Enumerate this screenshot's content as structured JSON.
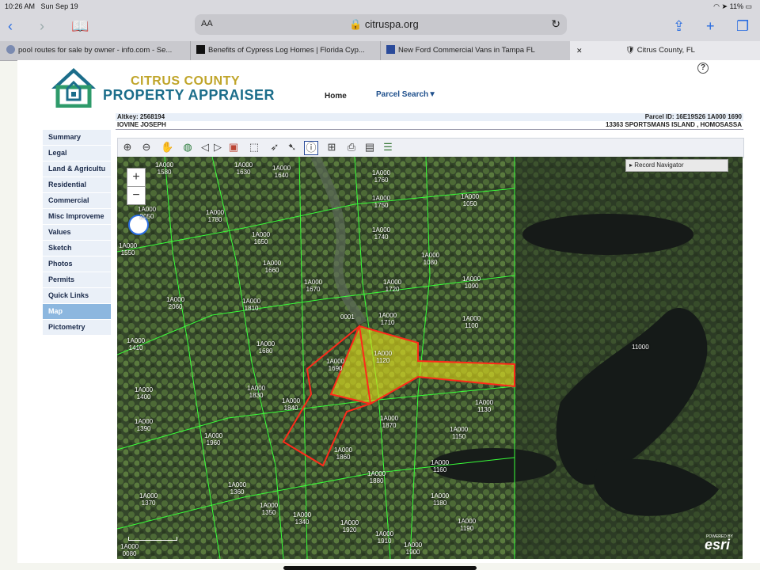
{
  "status": {
    "time": "10:26 AM",
    "date": "Sun Sep 19",
    "battery": "11%"
  },
  "browser": {
    "aa_label": "AA",
    "url": "citruspa.org",
    "tabs": [
      {
        "title": "pool routes for sale by owner - info.com - Se...",
        "active": false
      },
      {
        "title": "Benefits of Cypress Log Homes | Florida Cyp...",
        "active": false
      },
      {
        "title": "New Ford Commercial Vans in Tampa FL",
        "active": false
      },
      {
        "title": "Citrus County, FL",
        "active": true
      }
    ]
  },
  "site": {
    "logo_line1": "CITRUS COUNTY",
    "logo_line2": "PROPERTY APPRAISER",
    "nav_home": "Home",
    "nav_parcel": "Parcel Search▼",
    "help": "?"
  },
  "parcel": {
    "altkey": "Altkey: 2568194",
    "parcel_id": "Parcel ID: 16E19S26 1A000 1690",
    "owner": "IOVINE JOSEPH",
    "address": "13363 SPORTSMANS ISLAND , HOMOSASSA"
  },
  "sidebar": {
    "items": [
      "Summary",
      "Legal",
      "Land & Agricultu",
      "Residential",
      "Commercial",
      "Misc Improveme",
      "Values",
      "Sketch",
      "Photos",
      "Permits",
      "Quick Links",
      "Map",
      "Pictometry"
    ],
    "active_index": 11
  },
  "map": {
    "record_navigator": "▸ Record Navigator",
    "zoom_in": "+",
    "zoom_out": "−",
    "esri_powered": "POWERED BY",
    "esri": "esri",
    "labels": [
      {
        "id": "1A000\n1580"
      },
      {
        "id": "1A000\n1630"
      },
      {
        "id": "1A000\n1640"
      },
      {
        "id": "1A000\n1760"
      },
      {
        "id": "1A000\n1750"
      },
      {
        "id": "1A000\n1740"
      },
      {
        "id": "1A000\n1050"
      },
      {
        "id": "1A000\n2050"
      },
      {
        "id": "1A000\n1780"
      },
      {
        "id": "1A000\n1650"
      },
      {
        "id": "1A000\n1660"
      },
      {
        "id": "1A000\n1670"
      },
      {
        "id": "1A000\n1550"
      },
      {
        "id": "1A000\n1080"
      },
      {
        "id": "1A000\n1090"
      },
      {
        "id": "1A000\n1720"
      },
      {
        "id": "1A000\n2060"
      },
      {
        "id": "1A000\n1810"
      },
      {
        "id": "1A000\n1710"
      },
      {
        "id": "1A000\n1100"
      },
      {
        "id": "1A000\n1410"
      },
      {
        "id": "1A000\n1680"
      },
      {
        "id": "1A000\n1690"
      },
      {
        "id": "1A000\n1120"
      },
      {
        "id": "11000"
      },
      {
        "id": "1A000\n1400"
      },
      {
        "id": "1A000\n1830"
      },
      {
        "id": "1A000\n1840"
      },
      {
        "id": "1A000\n1130"
      },
      {
        "id": "1A000\n1870"
      },
      {
        "id": "1A000\n1390"
      },
      {
        "id": "1A000\n1960"
      },
      {
        "id": "1A000\n1150"
      },
      {
        "id": "1A000\n1860"
      },
      {
        "id": "1A000\n1160"
      },
      {
        "id": "1A000\n1880"
      },
      {
        "id": "1A000\n1360"
      },
      {
        "id": "1A000\n1370"
      },
      {
        "id": "1A000\n1350"
      },
      {
        "id": "1A000\n1180"
      },
      {
        "id": "1A000\n1340"
      },
      {
        "id": "1A000\n1920"
      },
      {
        "id": "1A000\n1190"
      },
      {
        "id": "1A000\n1910"
      },
      {
        "id": "1A000\n1900"
      },
      {
        "id": "1A000\n0080"
      },
      {
        "id": "0001"
      }
    ]
  }
}
